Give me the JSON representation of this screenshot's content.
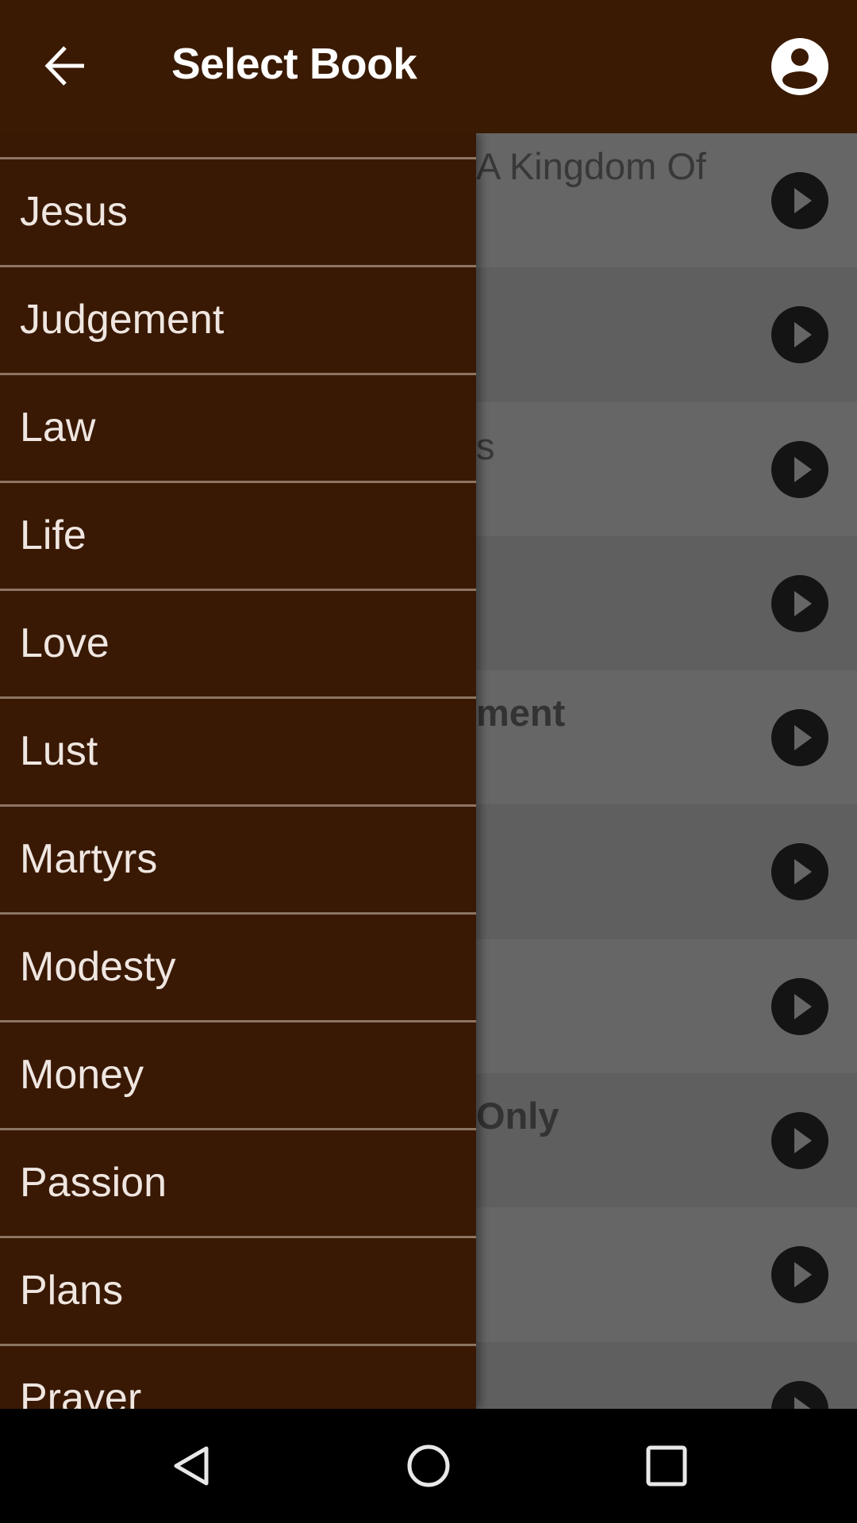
{
  "header": {
    "title": "Select Book",
    "back_icon": "arrow-left-icon",
    "account_icon": "account-circle-icon"
  },
  "colors": {
    "primary": "#3a1a02",
    "drawer_bg": "#391903",
    "drawer_divider": "#8c7563",
    "drawer_text": "#efe6e1"
  },
  "drawer": {
    "items": [
      {
        "label": ""
      },
      {
        "label": "Jesus"
      },
      {
        "label": "Judgement"
      },
      {
        "label": "Law"
      },
      {
        "label": "Life"
      },
      {
        "label": "Love"
      },
      {
        "label": "Lust"
      },
      {
        "label": "Martyrs"
      },
      {
        "label": "Modesty"
      },
      {
        "label": "Money"
      },
      {
        "label": "Passion"
      },
      {
        "label": "Plans"
      },
      {
        "label": "Prayer"
      }
    ]
  },
  "content": {
    "rows": [
      {
        "title": "A Kingdom Of",
        "play_icon": "play-circle-icon"
      },
      {
        "title": "",
        "play_icon": "play-circle-icon"
      },
      {
        "title": "s",
        "play_icon": "play-circle-icon"
      },
      {
        "title": "",
        "play_icon": "play-circle-icon"
      },
      {
        "title": "ment",
        "play_icon": "play-circle-icon"
      },
      {
        "title": "",
        "play_icon": "play-circle-icon"
      },
      {
        "title": "",
        "play_icon": "play-circle-icon"
      },
      {
        "title": "Only",
        "play_icon": "play-circle-icon"
      },
      {
        "title": "",
        "play_icon": "play-circle-icon"
      },
      {
        "title": "",
        "play_icon": "play-circle-icon"
      }
    ]
  },
  "navbar": {
    "back_icon": "nav-back-icon",
    "home_icon": "nav-home-icon",
    "recents_icon": "nav-recents-icon"
  }
}
